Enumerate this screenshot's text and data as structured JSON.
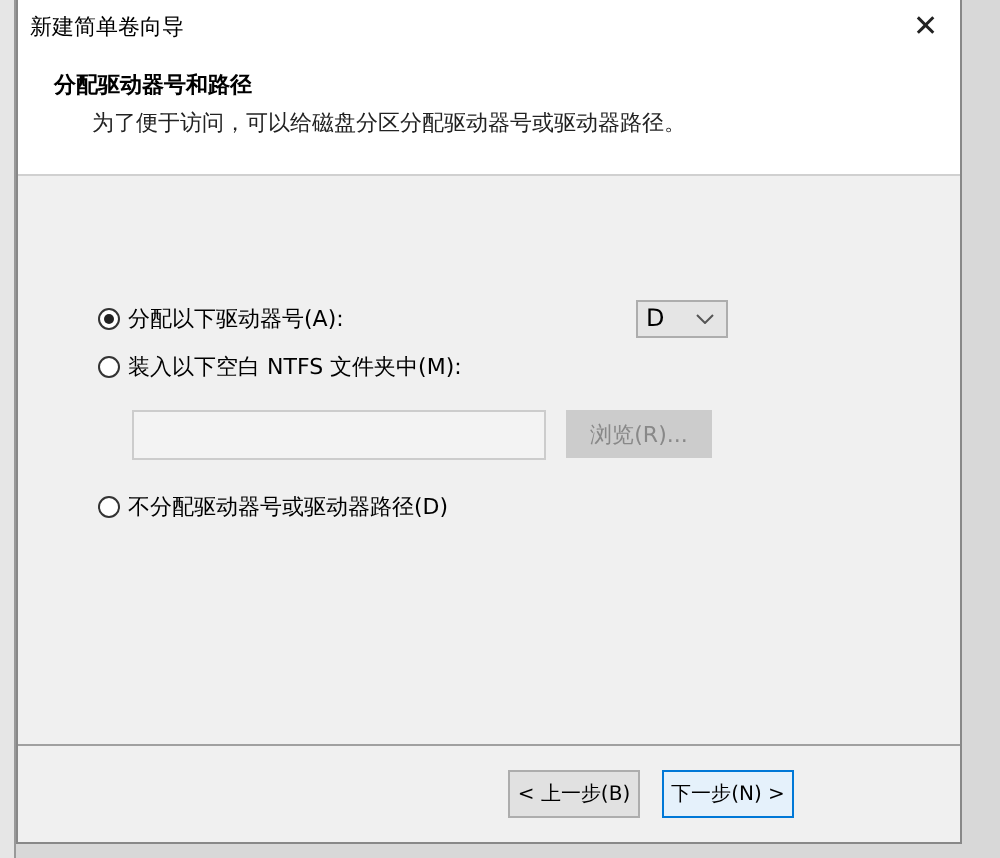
{
  "window": {
    "title": "新建简单卷向导",
    "close": "✕"
  },
  "header": {
    "title": "分配驱动器号和路径",
    "description": "为了便于访问，可以给磁盘分区分配驱动器号或驱动器路径。"
  },
  "options": [
    {
      "kind": "letter",
      "label": "分配以下驱动器号(A):",
      "selected": true,
      "value": "D"
    },
    {
      "kind": "folder",
      "label": "装入以下空白 NTFS 文件夹中(M):",
      "selected": false,
      "button": "浏览(R)..."
    },
    {
      "kind": "plain",
      "label": "不分配驱动器号或驱动器路径(D)",
      "selected": false
    }
  ],
  "buttons": [
    {
      "label": "< 上一步(B)",
      "default": false
    },
    {
      "label": "下一步(N) >",
      "default": true
    }
  ]
}
